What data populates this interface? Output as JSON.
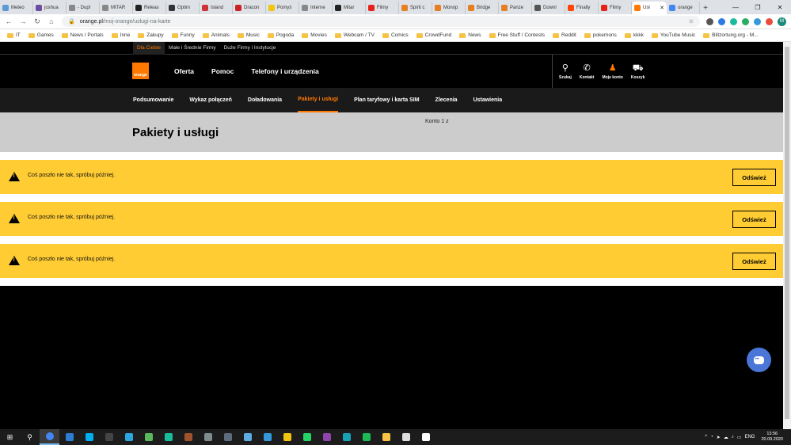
{
  "browser": {
    "tabs": [
      {
        "label": "Meteo",
        "color": "#5a9bd5"
      },
      {
        "label": "joshua",
        "color": "#6b4ca0"
      },
      {
        "label": "- Dupl",
        "color": "#888888"
      },
      {
        "label": "MITAR",
        "color": "#888888"
      },
      {
        "label": "Releas",
        "color": "#222222"
      },
      {
        "label": "Optim",
        "color": "#333333"
      },
      {
        "label": "Island",
        "color": "#cc3333"
      },
      {
        "label": "Dracon",
        "color": "#cc2222"
      },
      {
        "label": "Pomyś",
        "color": "#f1c40f"
      },
      {
        "label": "Interne",
        "color": "#888888"
      },
      {
        "label": "Mitar",
        "color": "#222222"
      },
      {
        "label": "Filmy",
        "color": "#e62117"
      },
      {
        "label": "Spirit c",
        "color": "#e67e22"
      },
      {
        "label": "Monop",
        "color": "#e67e22"
      },
      {
        "label": "Bridge",
        "color": "#e67e22"
      },
      {
        "label": "Panze",
        "color": "#e67e22"
      },
      {
        "label": "Downl",
        "color": "#555555"
      },
      {
        "label": "Finally",
        "color": "#ff4500"
      },
      {
        "label": "Filmy",
        "color": "#e62117"
      },
      {
        "label": "Usł",
        "color": "#ff7900",
        "active": true
      },
      {
        "label": "orange",
        "color": "#4285f4"
      }
    ],
    "new_tab": "+",
    "win_minimize": "—",
    "win_maximize": "❐",
    "win_close": "✕",
    "back": "←",
    "forward": "→",
    "reload": "↻",
    "home": "⌂",
    "url_host": "orange.pl",
    "url_path": "/moj-orange/uslugi-na-karte",
    "star": "☆",
    "profile_initial": "M",
    "bookmarks": [
      "IT",
      "Games",
      "News / Portals",
      "Inne",
      "Zakupy",
      "Funny",
      "Animals",
      "Music",
      "Pogoda",
      "Movies",
      "Webcam / TV",
      "Comics",
      "CrowdFund",
      "News",
      "Free Stuff / Contests",
      "Reddit",
      "pokemons",
      "kkkk",
      "YouTube Music",
      "Blitzortung.org - M..."
    ]
  },
  "site": {
    "segments": [
      "Dla Ciebie",
      "Małe i Średnie Firmy",
      "Duże Firmy i Instytucje"
    ],
    "logo_text": "orange",
    "main_links": [
      "Oferta",
      "Pomoc",
      "Telefony i urządzenia"
    ],
    "icons": [
      {
        "name": "search-icon",
        "glyph": "⚲",
        "label": "Szukaj"
      },
      {
        "name": "phone-icon",
        "glyph": "✆",
        "label": "Kontakt"
      },
      {
        "name": "user-icon",
        "glyph": "♟",
        "label": "Moje konto",
        "orange": true
      },
      {
        "name": "cart-icon",
        "glyph": "⛟",
        "label": "Koszyk"
      }
    ],
    "subnav": [
      "Podsumowanie",
      "Wykaz połączeń",
      "Doładowania",
      "Pakiety i usługi",
      "Plan taryfowy i karta SIM",
      "Zlecenia",
      "Ustawienia"
    ],
    "subnav_active_index": 3,
    "page_title": "Pakiety i usługi",
    "konto": "Konto 1 z",
    "alerts": [
      {
        "message": "Coś poszło nie tak, spróbuj później.",
        "button": "Odśwież"
      },
      {
        "message": "Coś poszło nie tak, spróbuj później.",
        "button": "Odśwież"
      },
      {
        "message": "Coś poszło nie tak, spróbuj później.",
        "button": "Odśwież"
      }
    ],
    "accent_color": "#ff7900",
    "alert_color": "#ffcc33"
  },
  "taskbar": {
    "start_glyph": "⊞",
    "search_glyph": "⚲",
    "apps": [
      {
        "name": "chrome",
        "color": "#4285f4",
        "active": true
      },
      {
        "name": "app-blue",
        "color": "#2d7dd2"
      },
      {
        "name": "skype",
        "color": "#00aff0"
      },
      {
        "name": "app-dark",
        "color": "#444444"
      },
      {
        "name": "telegram",
        "color": "#2ca5e0"
      },
      {
        "name": "app-green",
        "color": "#5cb85c"
      },
      {
        "name": "app-teal",
        "color": "#1abc9c"
      },
      {
        "name": "app-brown",
        "color": "#a0522d"
      },
      {
        "name": "app-gray",
        "color": "#7f8c8d"
      },
      {
        "name": "app-steel",
        "color": "#5d6d7e"
      },
      {
        "name": "app-lightblue",
        "color": "#5dade2"
      },
      {
        "name": "app-vs",
        "color": "#3498db"
      },
      {
        "name": "app-yellow",
        "color": "#f1c40f"
      },
      {
        "name": "whatsapp",
        "color": "#25d366"
      },
      {
        "name": "app-purple",
        "color": "#8e44ad"
      },
      {
        "name": "app-cyan",
        "color": "#17a2b8"
      },
      {
        "name": "spotify",
        "color": "#1db954"
      },
      {
        "name": "explorer",
        "color": "#f6c345"
      },
      {
        "name": "app-white",
        "color": "#dddddd"
      },
      {
        "name": "onedrive",
        "color": "#ffffff"
      }
    ],
    "tray": [
      "^",
      "◔",
      "➤",
      "☁",
      "♪",
      "▭",
      "ENG"
    ],
    "time": "13:56",
    "date": "20.09.2020"
  }
}
